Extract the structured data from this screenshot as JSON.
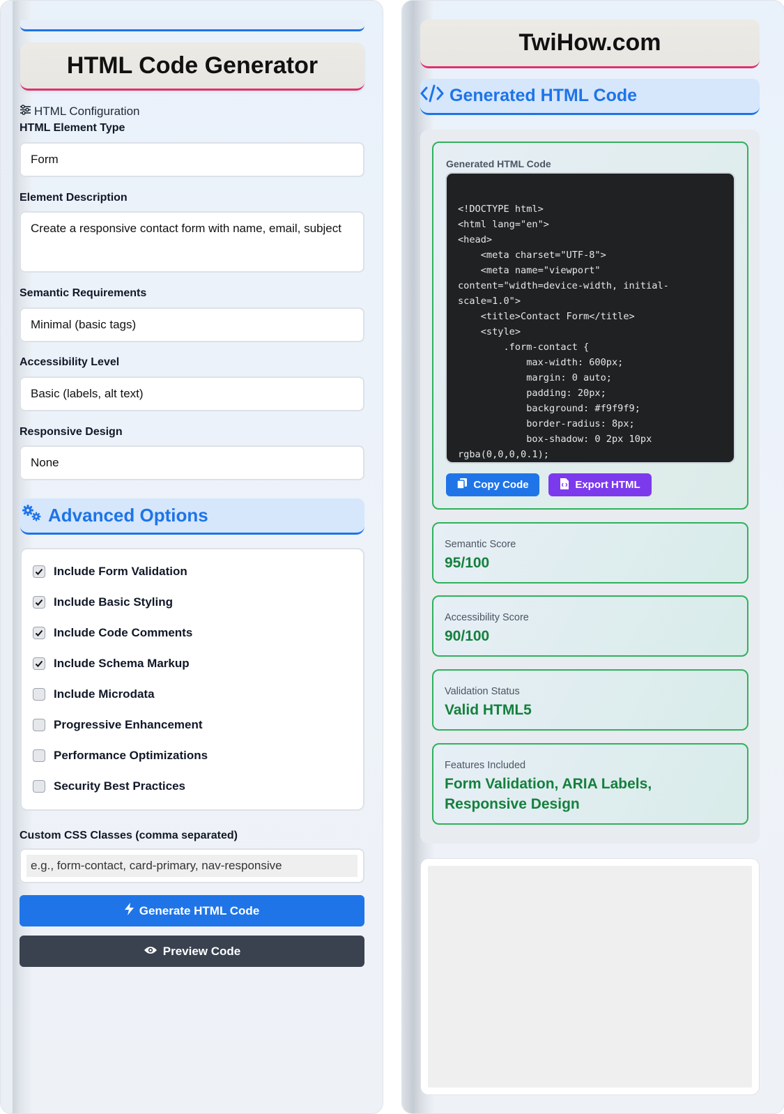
{
  "left": {
    "title": "HTML Code Generator",
    "config_section_label": "HTML Configuration",
    "fields": [
      {
        "label": "HTML Element Type",
        "value": "Form"
      },
      {
        "label": "Element Description",
        "value": "Create a responsive contact form with name, email, subject"
      },
      {
        "label": "Semantic Requirements",
        "value": "Minimal (basic tags)"
      },
      {
        "label": "Accessibility Level",
        "value": "Basic (labels, alt text)"
      },
      {
        "label": "Responsive Design",
        "value": "None"
      }
    ],
    "advanced_title": "Advanced Options",
    "options": [
      {
        "label": "Include Form Validation",
        "checked": true
      },
      {
        "label": "Include Basic Styling",
        "checked": true
      },
      {
        "label": "Include Code Comments",
        "checked": true
      },
      {
        "label": "Include Schema Markup",
        "checked": true
      },
      {
        "label": "Include Microdata",
        "checked": false
      },
      {
        "label": "Progressive Enhancement",
        "checked": false
      },
      {
        "label": "Performance Optimizations",
        "checked": false
      },
      {
        "label": "Security Best Practices",
        "checked": false
      }
    ],
    "css_classes_label": "Custom CSS Classes (comma separated)",
    "css_classes_placeholder": "e.g., form-contact, card-primary, nav-responsive",
    "generate_label": "Generate HTML Code",
    "preview_label": "Preview Code"
  },
  "right": {
    "brand": "TwiHow.com",
    "header": "Generated HTML Code",
    "code_card_title": "Generated HTML Code",
    "code": "<!DOCTYPE html>\n<html lang=\"en\">\n<head>\n    <meta charset=\"UTF-8\">\n    <meta name=\"viewport\"\ncontent=\"width=device-width, initial-\nscale=1.0\">\n    <title>Contact Form</title>\n    <style>\n        .form-contact {\n            max-width: 600px;\n            margin: 0 auto;\n            padding: 20px;\n            background: #f9f9f9;\n            border-radius: 8px;\n            box-shadow: 0 2px 10px\nrgba(0,0,0,0.1);",
    "copy_label": "Copy Code",
    "export_label": "Export HTML",
    "scores": [
      {
        "label": "Semantic Score",
        "value": "95/100"
      },
      {
        "label": "Accessibility Score",
        "value": "90/100"
      },
      {
        "label": "Validation Status",
        "value": "Valid HTML5"
      },
      {
        "label": "Features Included",
        "value": "Form Validation, ARIA Labels, Responsive Design"
      }
    ]
  },
  "colors": {
    "accent_blue": "#1d74e8",
    "accent_pink": "#e1306c",
    "success_green": "#15803d",
    "export_purple": "#7c3aed",
    "dark_button": "#3a4250"
  }
}
